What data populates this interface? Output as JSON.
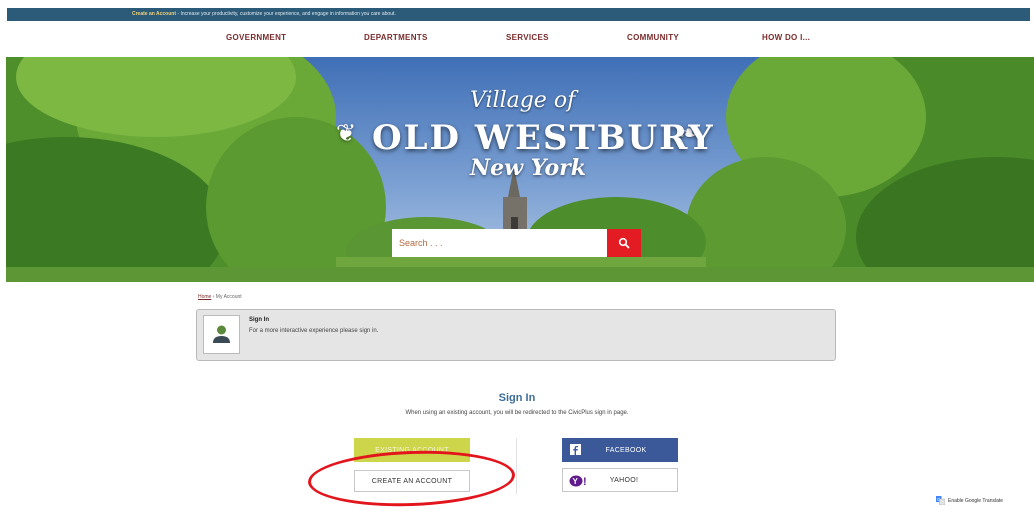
{
  "topbar": {
    "link": "Create an Account",
    "text": " - Increase your productivity, customize your experience, and engage in information you care about."
  },
  "nav": {
    "items": [
      "GOVERNMENT",
      "DEPARTMENTS",
      "SERVICES",
      "COMMUNITY",
      "HOW DO I..."
    ]
  },
  "hero": {
    "logo_line1": "Village of",
    "logo_line2": "OLD WESTBURY",
    "logo_line3": "New York"
  },
  "search": {
    "placeholder": "Search . . ."
  },
  "breadcrumb": {
    "home": "Home",
    "separator": " › ",
    "current": "My Account"
  },
  "signin_panel": {
    "title": "Sign In",
    "description": "For a more interactive experience please sign in."
  },
  "signin": {
    "heading": "Sign In",
    "info": "When using an existing account, you will be redirected to the CivicPlus sign in page."
  },
  "buttons": {
    "existing_account": "EXISTING ACCOUNT",
    "create_account": "CREATE AN ACCOUNT",
    "facebook": "FACEBOOK",
    "yahoo": "YAHOO!"
  },
  "translate": {
    "label": "Enable Google Translate"
  },
  "colors": {
    "topbar": "#2c5b79",
    "nav_text": "#7a2c2c",
    "search_button": "#e31b23",
    "heading": "#3d6e99",
    "existing_button": "#cdd54a",
    "facebook": "#3b5998",
    "yahoo": "#5f1a8e",
    "annotation_circle": "#e3151c"
  },
  "icons": {
    "search": "magnifier-icon",
    "user": "user-silhouette-icon",
    "facebook": "facebook-f-icon",
    "yahoo": "yahoo-logo-icon",
    "translate": "google-translate-icon"
  }
}
